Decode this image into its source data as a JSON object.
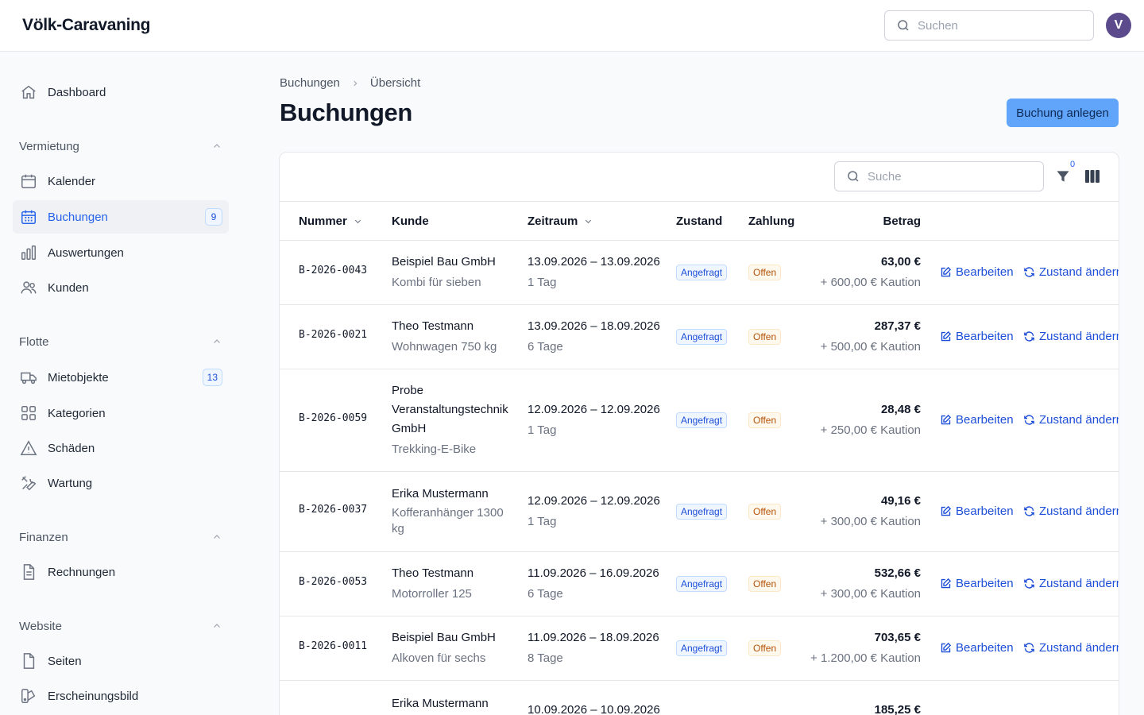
{
  "app": {
    "brand": "Völk-Caravaning",
    "search_placeholder": "Suchen",
    "avatar_initial": "V"
  },
  "sidebar": {
    "dashboard": "Dashboard",
    "sections": {
      "vermietung": "Vermietung",
      "flotte": "Flotte",
      "finanzen": "Finanzen",
      "website": "Website"
    },
    "items": {
      "kalender": "Kalender",
      "buchungen": "Buchungen",
      "buchungen_badge": "9",
      "auswertungen": "Auswertungen",
      "kunden": "Kunden",
      "mietobjekte": "Mietobjekte",
      "mietobjekte_badge": "13",
      "kategorien": "Kategorien",
      "schaeden": "Schäden",
      "wartung": "Wartung",
      "rechnungen": "Rechnungen",
      "seiten": "Seiten",
      "erscheinungsbild": "Erscheinungsbild"
    }
  },
  "breadcrumb": {
    "parent": "Buchungen",
    "current": "Übersicht"
  },
  "page": {
    "title": "Buchungen",
    "create_button": "Buchung anlegen"
  },
  "table": {
    "search_placeholder": "Suche",
    "filter_count": "0",
    "columns": {
      "nummer": "Nummer",
      "kunde": "Kunde",
      "zeitraum": "Zeitraum",
      "zustand": "Zustand",
      "zahlung": "Zahlung",
      "betrag": "Betrag"
    },
    "action_edit": "Bearbeiten",
    "action_state": "Zustand ändern",
    "rows": [
      {
        "number": "B-2026-0043",
        "customer": "Beispiel Bau GmbH",
        "object": "Kombi für sieben",
        "period": "13.09.2026 – 13.09.2026",
        "duration": "1 Tag",
        "state": "Angefragt",
        "payment": "Offen",
        "amount": "63,00 €",
        "deposit": "+ 600,00 € Kaution"
      },
      {
        "number": "B-2026-0021",
        "customer": "Theo Testmann",
        "object": "Wohnwagen 750 kg",
        "period": "13.09.2026 – 18.09.2026",
        "duration": "6 Tage",
        "state": "Angefragt",
        "payment": "Offen",
        "amount": "287,37 €",
        "deposit": "+ 500,00 € Kaution"
      },
      {
        "number": "B-2026-0059",
        "customer_lines": [
          "Probe",
          "Veranstaltungstechnik",
          "GmbH"
        ],
        "object": "Trekking-E-Bike",
        "period": "12.09.2026 – 12.09.2026",
        "duration": "1 Tag",
        "state": "Angefragt",
        "payment": "Offen",
        "amount": "28,48 €",
        "deposit": "+ 250,00 € Kaution"
      },
      {
        "number": "B-2026-0037",
        "customer": "Erika Mustermann",
        "object_lines": [
          "Kofferanhänger 1300",
          "kg"
        ],
        "period": "12.09.2026 – 12.09.2026",
        "duration": "1 Tag",
        "state": "Angefragt",
        "payment": "Offen",
        "amount": "49,16 €",
        "deposit": "+ 300,00 € Kaution"
      },
      {
        "number": "B-2026-0053",
        "customer": "Theo Testmann",
        "object": "Motorroller 125",
        "period": "11.09.2026 – 16.09.2026",
        "duration": "6 Tage",
        "state": "Angefragt",
        "payment": "Offen",
        "amount": "532,66 €",
        "deposit": "+ 300,00 € Kaution"
      },
      {
        "number": "B-2026-0011",
        "customer": "Beispiel Bau GmbH",
        "object": "Alkoven für sechs",
        "period": "11.09.2026 – 18.09.2026",
        "duration": "8 Tage",
        "state": "Angefragt",
        "payment": "Offen",
        "amount": "703,65 €",
        "deposit": "+ 1.200,00 € Kaution"
      },
      {
        "customer": "Erika Mustermann",
        "period": "10.09.2026 – 10.09.2026",
        "amount": "185,25 €"
      }
    ]
  },
  "icons": {
    "dashboard": "home-icon",
    "kalender": "calendar-icon",
    "buchungen": "calendar-grid-icon",
    "auswertungen": "bar-chart-icon",
    "kunden": "users-icon",
    "mietobjekte": "truck-icon",
    "kategorien": "squares-icon",
    "schaeden": "warning-icon",
    "wartung": "wrench-icon",
    "rechnungen": "document-icon",
    "seiten": "page-icon",
    "erscheinungsbild": "swatch-icon"
  },
  "colors": {
    "accent": "#2563eb",
    "primary_button": "#60a5fa",
    "avatar": "#5b4a8c",
    "badge_blue_bg": "#eff6ff",
    "badge_orange_bg": "#fff8ed"
  }
}
